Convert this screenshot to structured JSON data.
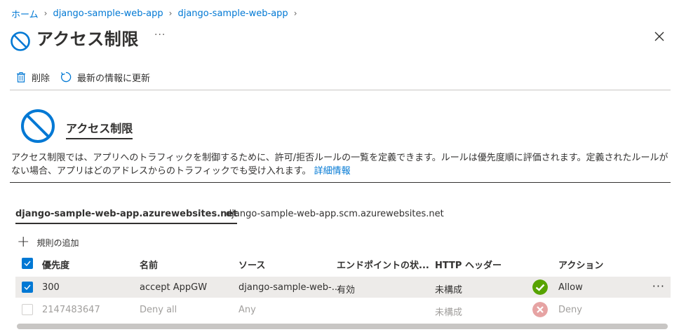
{
  "breadcrumb": [
    {
      "label": "ホーム"
    },
    {
      "label": "django-sample-web-app"
    },
    {
      "label": "django-sample-web-app"
    }
  ],
  "page": {
    "title": "アクセス制限",
    "more": "···"
  },
  "toolbar": {
    "delete_label": "削除",
    "refresh_label": "最新の情報に更新"
  },
  "hero": {
    "title": "アクセス制限",
    "description": "アクセス制限では、アプリへのトラフィックを制御するために、許可/拒否ルールの一覧を定義できます。ルールは優先度順に評価されます。定義されたルールがない場合、アプリはどのアドレスからのトラフィックでも受け入れます。",
    "learn_more": "詳細情報"
  },
  "tabs": [
    {
      "label": "django-sample-web-app.azurewebsites.net",
      "active": true
    },
    {
      "label": "django-sample-web-app.scm.azurewebsites.net",
      "active": false
    }
  ],
  "add_rule_label": "規則の追加",
  "table": {
    "headers": {
      "priority": "優先度",
      "name": "名前",
      "source": "ソース",
      "endpoint": "エンドポイントの状...",
      "http_headers": "HTTP ヘッダー",
      "action": "アクション"
    },
    "rows": [
      {
        "priority": "300",
        "name": "accept AppGW",
        "source": "django-sample-web-...",
        "endpoint": "有効",
        "http_headers": "未構成",
        "action": "Allow",
        "row_more": "···"
      },
      {
        "priority": "2147483647",
        "name": "Deny all",
        "source": "Any",
        "endpoint": "",
        "http_headers": "未構成",
        "action": "Deny"
      }
    ]
  },
  "colors": {
    "accent": "#0078d4",
    "allow": "#57a300",
    "deny": "#e6a3a3"
  }
}
